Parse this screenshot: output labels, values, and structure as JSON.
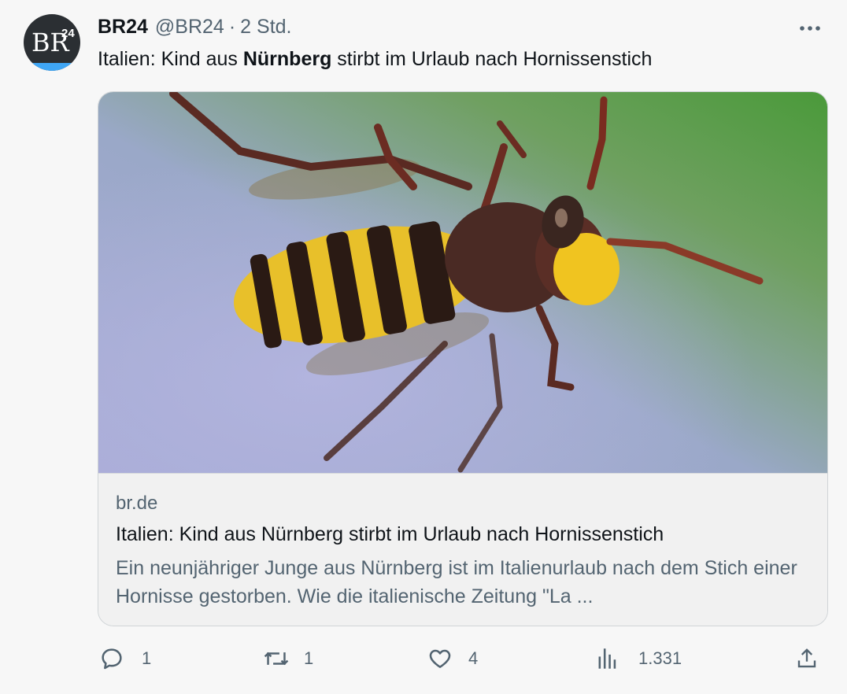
{
  "author": {
    "name": "BR24",
    "handle": "@BR24",
    "separator": "·",
    "time": "2 Std.",
    "avatar_text": "BR",
    "avatar_sup": "24"
  },
  "tweet": {
    "text_before": "Italien: Kind aus ",
    "text_bold": "Nürnberg",
    "text_after": " stirbt im Urlaub nach Hornissenstich"
  },
  "card": {
    "domain": "br.de",
    "title": "Italien: Kind aus Nürnberg stirbt im Urlaub nach Hornissenstich",
    "description": "Ein neunjähriger Junge aus Nürnberg ist im Italienurlaub nach dem Stich einer Hornisse gestorben. Wie die italienische Zeitung \"La ..."
  },
  "actions": {
    "reply_count": "1",
    "retweet_count": "1",
    "like_count": "4",
    "views_count": "1.331"
  },
  "icons": {
    "reply": "reply-icon",
    "retweet": "retweet-icon",
    "like": "heart-icon",
    "views": "views-icon",
    "share": "share-icon",
    "more": "more-icon"
  },
  "colors": {
    "secondary_text": "#536471",
    "avatar_bg": "#2b2f33",
    "avatar_accent": "#3fa6f5"
  }
}
